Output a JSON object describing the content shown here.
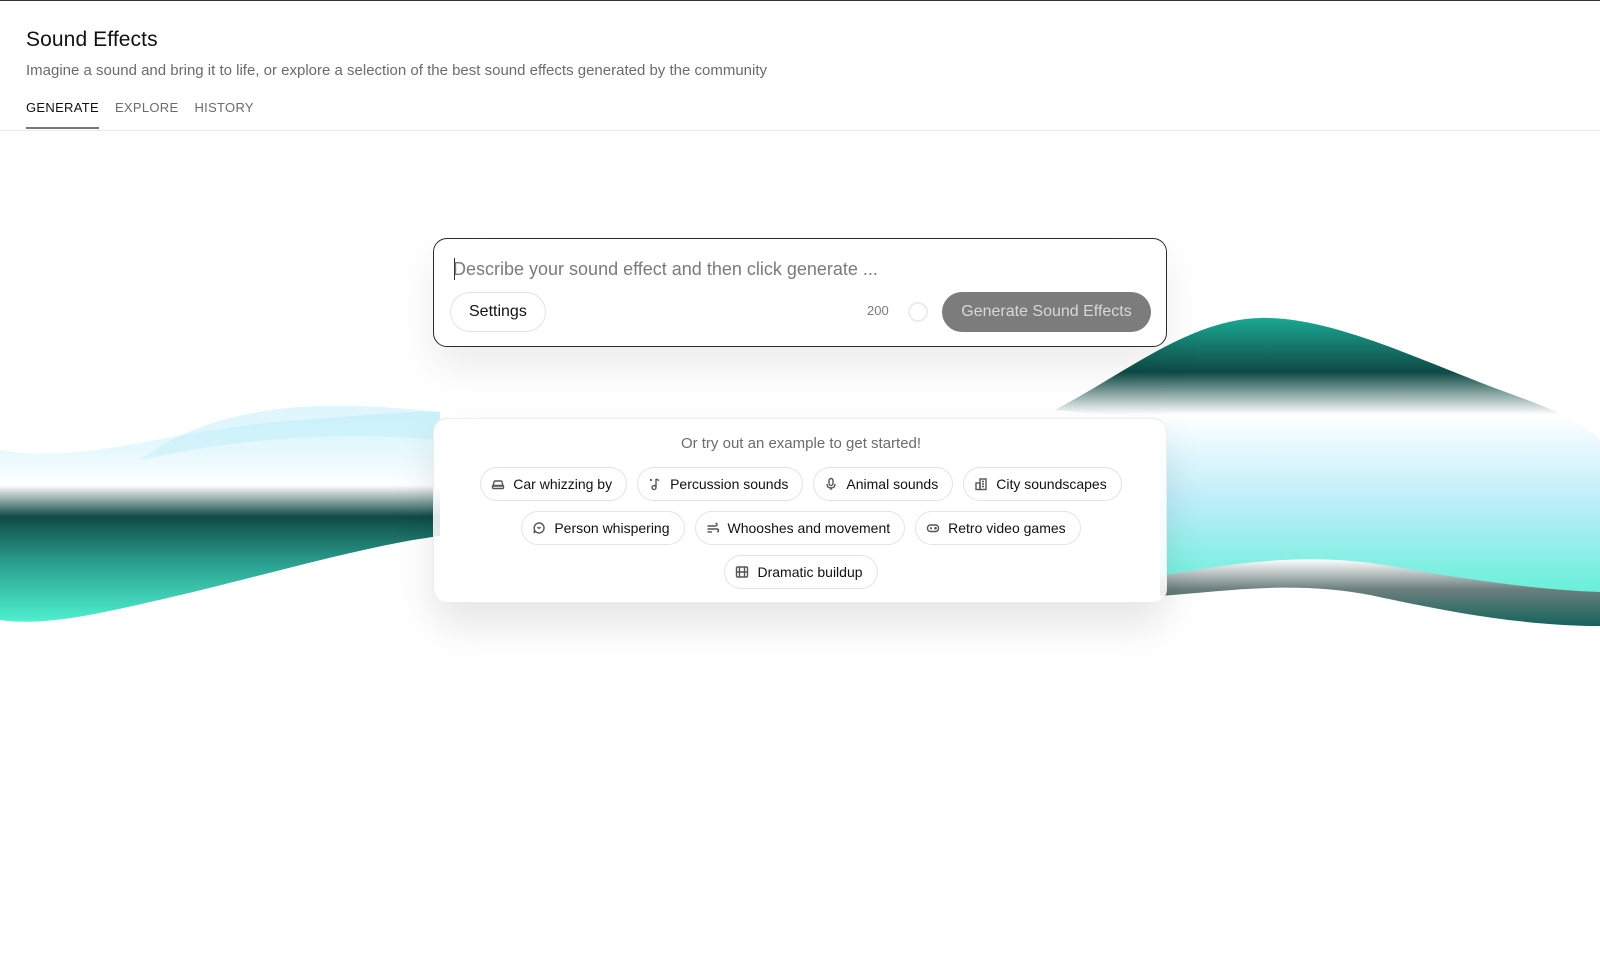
{
  "header": {
    "title": "Sound Effects",
    "subtitle": "Imagine a sound and bring it to life, or explore a selection of the best sound effects generated by the community"
  },
  "tabs": [
    {
      "label": "GENERATE",
      "active": true
    },
    {
      "label": "EXPLORE",
      "active": false
    },
    {
      "label": "HISTORY",
      "active": false
    }
  ],
  "prompt": {
    "placeholder": "Describe your sound effect and then click generate ...",
    "value": "",
    "settings_label": "Settings",
    "char_count": "200",
    "generate_label": "Generate Sound Effects"
  },
  "examples": {
    "heading": "Or try out an example to get started!",
    "chips": [
      {
        "label": "Car whizzing by",
        "icon": "car-icon"
      },
      {
        "label": "Percussion sounds",
        "icon": "music-note-icon"
      },
      {
        "label": "Animal sounds",
        "icon": "microphone-icon"
      },
      {
        "label": "City soundscapes",
        "icon": "buildings-icon"
      },
      {
        "label": "Person whispering",
        "icon": "chat-bubble-icon"
      },
      {
        "label": "Whooshes and movement",
        "icon": "wind-icon"
      },
      {
        "label": "Retro video games",
        "icon": "gamepad-icon"
      },
      {
        "label": "Dramatic buildup",
        "icon": "film-icon"
      }
    ]
  },
  "colors": {
    "accent_teal": "#4ef0cf",
    "dark_teal": "#0f4a45",
    "button_disabled": "#7c7c7c"
  }
}
